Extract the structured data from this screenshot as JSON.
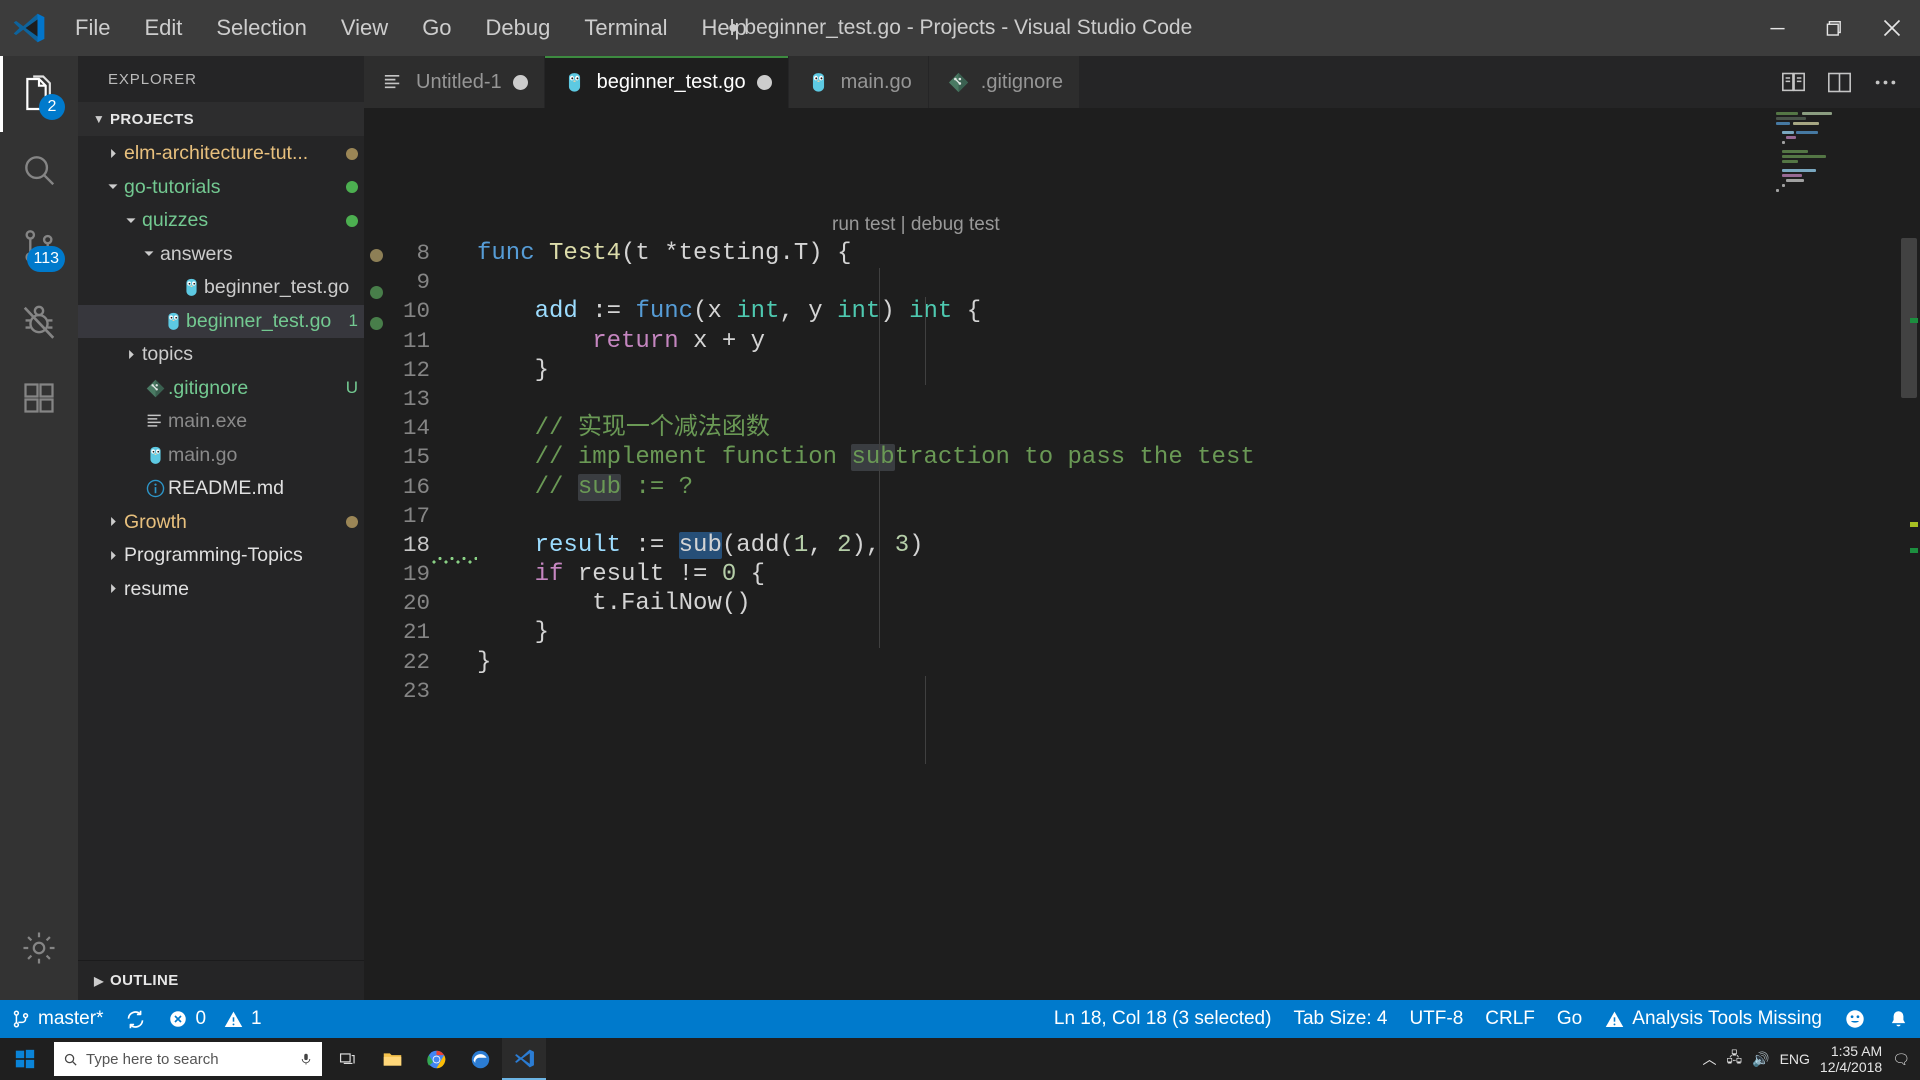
{
  "window": {
    "title": "beginner_test.go - Projects - Visual Studio Code",
    "dirty_marker": "●",
    "logo_icon": "vscode-logo-icon",
    "minimize_label": "Minimize",
    "maximize_label": "Restore",
    "close_label": "Close"
  },
  "menubar": {
    "items": [
      {
        "label": "File"
      },
      {
        "label": "Edit"
      },
      {
        "label": "Selection"
      },
      {
        "label": "View"
      },
      {
        "label": "Go"
      },
      {
        "label": "Debug"
      },
      {
        "label": "Terminal"
      },
      {
        "label": "Help"
      }
    ]
  },
  "activitybar": {
    "items": [
      {
        "name": "explorer",
        "icon": "files-icon",
        "badge": "2",
        "active": true
      },
      {
        "name": "search",
        "icon": "search-icon",
        "badge": "",
        "active": false
      },
      {
        "name": "source-control",
        "icon": "source-control-icon",
        "badge": "113",
        "active": false
      },
      {
        "name": "debug",
        "icon": "debug-no-icon",
        "badge": "",
        "active": false
      },
      {
        "name": "extensions",
        "icon": "extensions-icon",
        "badge": "",
        "active": false
      }
    ],
    "bottom": [
      {
        "name": "manage",
        "icon": "gear-icon"
      }
    ]
  },
  "sidebar": {
    "title": "EXPLORER",
    "section": "PROJECTS",
    "outline": "OUTLINE",
    "tree": [
      {
        "label": "elm-architecture-tut...",
        "indent": 1,
        "type": "folder",
        "expanded": false,
        "color": "#e8c07d",
        "icon": "chevron-right-icon",
        "git": "dot",
        "gitcolor": "#9b8656"
      },
      {
        "label": "go-tutorials",
        "indent": 1,
        "type": "folder",
        "expanded": true,
        "color": "#73c991",
        "icon": "chevron-down-icon",
        "git": "dot",
        "gitcolor": "#4caf50"
      },
      {
        "label": "quizzes",
        "indent": 2,
        "type": "folder",
        "expanded": true,
        "color": "#73c991",
        "icon": "chevron-down-icon",
        "git": "dot",
        "gitcolor": "#4caf50"
      },
      {
        "label": "answers",
        "indent": 3,
        "type": "folder",
        "expanded": true,
        "color": "#cccccc",
        "icon": "chevron-down-icon",
        "git": "",
        "gitcolor": ""
      },
      {
        "label": "beginner_test.go",
        "indent": 4,
        "type": "go-file",
        "expanded": false,
        "color": "#cccccc",
        "icon": "go-gopher-icon",
        "git": "",
        "gitcolor": ""
      },
      {
        "label": "beginner_test.go",
        "indent": 3,
        "type": "go-file",
        "expanded": false,
        "color": "#73c991",
        "icon": "go-gopher-icon",
        "git": "letter",
        "gitletter": "1",
        "gitcolor": "#73c991",
        "selected": true
      },
      {
        "label": "topics",
        "indent": 2,
        "type": "folder",
        "expanded": false,
        "color": "#cccccc",
        "icon": "chevron-right-icon",
        "git": "",
        "gitcolor": ""
      },
      {
        "label": ".gitignore",
        "indent": 2,
        "type": "git-file",
        "expanded": false,
        "color": "#73c991",
        "icon": "git-icon",
        "git": "letter",
        "gitletter": "U",
        "gitcolor": "#73c991"
      },
      {
        "label": "main.exe",
        "indent": 2,
        "type": "bin-file",
        "expanded": false,
        "color": "#8a8a8a",
        "icon": "binary-file-icon",
        "git": "",
        "gitcolor": ""
      },
      {
        "label": "main.go",
        "indent": 2,
        "type": "go-file",
        "expanded": false,
        "color": "#8a8a8a",
        "icon": "go-gopher-icon",
        "git": "",
        "gitcolor": ""
      },
      {
        "label": "README.md",
        "indent": 2,
        "type": "md-file",
        "expanded": false,
        "color": "#e0e0e0",
        "icon": "info-circle-icon",
        "git": "",
        "gitcolor": ""
      },
      {
        "label": "Growth",
        "indent": 1,
        "type": "folder",
        "expanded": false,
        "color": "#e8c07d",
        "icon": "chevron-right-icon",
        "git": "dot",
        "gitcolor": "#9b8656"
      },
      {
        "label": "Programming-Topics",
        "indent": 1,
        "type": "folder",
        "expanded": false,
        "color": "#e0e0e0",
        "icon": "chevron-right-icon",
        "git": "",
        "gitcolor": ""
      },
      {
        "label": "resume",
        "indent": 1,
        "type": "folder",
        "expanded": false,
        "color": "#e0e0e0",
        "icon": "chevron-right-icon",
        "git": "",
        "gitcolor": ""
      }
    ]
  },
  "tabs": {
    "items": [
      {
        "label": "Untitled-1",
        "icon": "plain-file-icon",
        "dirty": true,
        "active": false
      },
      {
        "label": "beginner_test.go",
        "icon": "go-gopher-icon",
        "dirty": true,
        "active": true
      },
      {
        "label": "main.go",
        "icon": "go-gopher-icon",
        "dirty": false,
        "active": false
      },
      {
        "label": ".gitignore",
        "icon": "git-icon",
        "dirty": false,
        "active": false
      }
    ],
    "actions": [
      {
        "name": "open-changes-icon",
        "label": "Open Changes"
      },
      {
        "name": "split-editor-icon",
        "label": "Split Editor"
      },
      {
        "name": "more-actions-icon",
        "label": "More Actions..."
      }
    ]
  },
  "editor": {
    "codelens": {
      "run": "run test",
      "separator": "|",
      "debug": "debug test"
    },
    "first_line_number": 8,
    "lines": [
      {
        "n": 8,
        "tokens": [
          {
            "t": "func ",
            "c": "k"
          },
          {
            "t": "Test4",
            "c": "fn"
          },
          {
            "t": "(t *testing.T) {",
            "c": "pl"
          }
        ]
      },
      {
        "n": 9,
        "tokens": []
      },
      {
        "n": 10,
        "tokens": [
          {
            "t": "    ",
            "c": "pl"
          },
          {
            "t": "add",
            "c": "va"
          },
          {
            "t": " := ",
            "c": "pl"
          },
          {
            "t": "func",
            "c": "k"
          },
          {
            "t": "(x ",
            "c": "pl"
          },
          {
            "t": "int",
            "c": "ty"
          },
          {
            "t": ", y ",
            "c": "pl"
          },
          {
            "t": "int",
            "c": "ty"
          },
          {
            "t": ") ",
            "c": "pl"
          },
          {
            "t": "int",
            "c": "ty"
          },
          {
            "t": " {",
            "c": "pl"
          }
        ]
      },
      {
        "n": 11,
        "tokens": [
          {
            "t": "        ",
            "c": "pl"
          },
          {
            "t": "return",
            "c": "kc"
          },
          {
            "t": " x + y",
            "c": "pl"
          }
        ]
      },
      {
        "n": 12,
        "tokens": [
          {
            "t": "    }",
            "c": "pl"
          }
        ]
      },
      {
        "n": 13,
        "tokens": []
      },
      {
        "n": 14,
        "tokens": [
          {
            "t": "    ",
            "c": "pl"
          },
          {
            "t": "// 实现一个减法函数",
            "c": "cm"
          }
        ]
      },
      {
        "n": 15,
        "tokens": [
          {
            "t": "    ",
            "c": "pl"
          },
          {
            "t": "// implement function ",
            "c": "cm"
          },
          {
            "t": "sub",
            "c": "cm occ"
          },
          {
            "t": "traction to pass the test",
            "c": "cm"
          }
        ]
      },
      {
        "n": 16,
        "tokens": [
          {
            "t": "    ",
            "c": "pl"
          },
          {
            "t": "// ",
            "c": "cm"
          },
          {
            "t": "sub",
            "c": "cm occ"
          },
          {
            "t": " := ?",
            "c": "cm"
          }
        ]
      },
      {
        "n": 17,
        "tokens": []
      },
      {
        "n": 18,
        "current": true,
        "error": true,
        "tokens": [
          {
            "t": "    ",
            "c": "pl"
          },
          {
            "t": "result",
            "c": "va"
          },
          {
            "t": " := ",
            "c": "pl"
          },
          {
            "t": "sub",
            "c": "pl sel"
          },
          {
            "t": "(",
            "c": "pl"
          },
          {
            "t": "add",
            "c": "pl"
          },
          {
            "t": "(",
            "c": "pl"
          },
          {
            "t": "1",
            "c": "nu"
          },
          {
            "t": ", ",
            "c": "pl"
          },
          {
            "t": "2",
            "c": "nu"
          },
          {
            "t": "), ",
            "c": "pl"
          },
          {
            "t": "3",
            "c": "nu"
          },
          {
            "t": ")",
            "c": "pl"
          }
        ]
      },
      {
        "n": 19,
        "tokens": [
          {
            "t": "    ",
            "c": "pl"
          },
          {
            "t": "if",
            "c": "kc"
          },
          {
            "t": " result != ",
            "c": "pl"
          },
          {
            "t": "0",
            "c": "nu"
          },
          {
            "t": " {",
            "c": "pl"
          }
        ]
      },
      {
        "n": 20,
        "tokens": [
          {
            "t": "        t.",
            "c": "pl"
          },
          {
            "t": "FailNow",
            "c": "pl"
          },
          {
            "t": "()",
            "c": "pl"
          }
        ]
      },
      {
        "n": 21,
        "tokens": [
          {
            "t": "    }",
            "c": "pl"
          }
        ]
      },
      {
        "n": 22,
        "tokens": [
          {
            "t": "}",
            "c": "pl"
          }
        ]
      },
      {
        "n": 23,
        "tokens": []
      }
    ]
  },
  "statusbar": {
    "left": [
      {
        "name": "branch",
        "icon": "source-control-branch-icon",
        "label": "master*"
      },
      {
        "name": "sync",
        "icon": "sync-icon",
        "label": ""
      },
      {
        "name": "errors",
        "icon": "error-circle-icon",
        "label": "0"
      },
      {
        "name": "warnings",
        "icon": "warning-triangle-icon",
        "label": "1"
      }
    ],
    "right": [
      {
        "name": "cursor-position",
        "icon": "",
        "label": "Ln 18, Col 18 (3 selected)"
      },
      {
        "name": "tab-size",
        "icon": "",
        "label": "Tab Size: 4"
      },
      {
        "name": "encoding",
        "icon": "",
        "label": "UTF-8"
      },
      {
        "name": "eol",
        "icon": "",
        "label": "CRLF"
      },
      {
        "name": "language-mode",
        "icon": "",
        "label": "Go"
      },
      {
        "name": "go-analysis",
        "icon": "warning-triangle-icon",
        "label": "Analysis Tools Missing"
      },
      {
        "name": "feedback",
        "icon": "smiley-icon",
        "label": ""
      },
      {
        "name": "notifications",
        "icon": "bell-icon",
        "label": ""
      }
    ]
  },
  "taskbar": {
    "search_placeholder": "Type here to search",
    "icons": [
      {
        "name": "task-view-icon"
      },
      {
        "name": "file-explorer-icon"
      },
      {
        "name": "chrome-icon"
      },
      {
        "name": "edge-icon"
      },
      {
        "name": "vscode-taskbar-icon",
        "active": true
      }
    ],
    "tray": {
      "lang": "ENG",
      "time": "1:35 AM",
      "date": "12/4/2018"
    }
  },
  "colors": {
    "accent": "#007acc",
    "titlebar_bg": "#3c3c3c",
    "sidebar_bg": "#252526",
    "editor_bg": "#1e1e1e",
    "activitybar_bg": "#333333",
    "selection": "#264f78",
    "git_modified": "#73c991",
    "git_untracked": "#73c991",
    "folder_yellow": "#e8c07d"
  }
}
